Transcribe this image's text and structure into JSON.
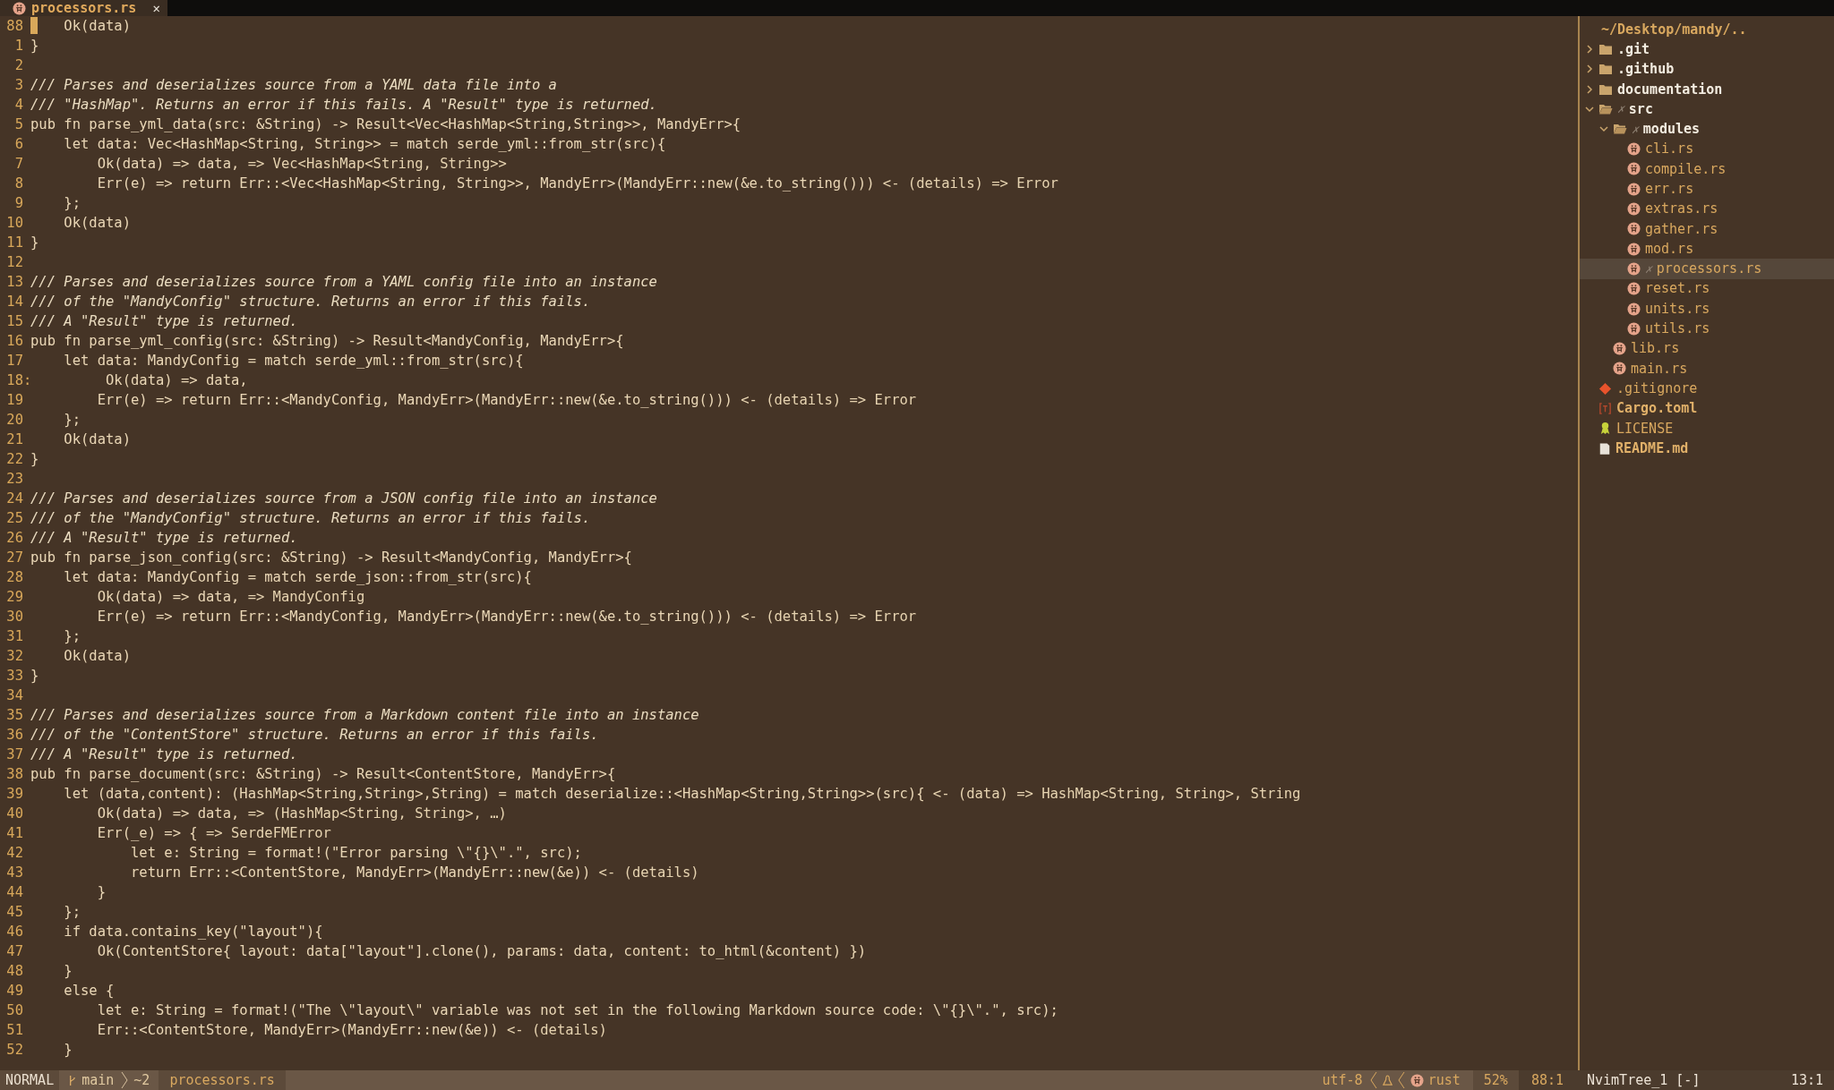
{
  "tab": {
    "title": "processors.rs",
    "selected": true,
    "close": "✕"
  },
  "editor": {
    "lines": [
      {
        "number": "88",
        "kind": "code",
        "code": "    Ok(data)",
        "cursor": true
      },
      {
        "number": "1",
        "kind": "code",
        "code": "}",
        "cursor": false
      },
      {
        "number": "2",
        "kind": "code",
        "cursor": false
      },
      {
        "number": "3",
        "kind": "comment",
        "code": "/// Parses and deserializes source from a YAML data file into a",
        "cursor": false
      },
      {
        "number": "4",
        "kind": "comment",
        "code": "/// \"HashMap\". Returns an error if this fails. A \"Result\" type is returned.",
        "cursor": false
      },
      {
        "number": "5",
        "kind": "code",
        "code": "pub fn parse_yml_data(src: &String) -> Result<Vec<HashMap<String,String>>, MandyErr>{",
        "cursor": false
      },
      {
        "number": "6",
        "kind": "code",
        "code": "    let data: Vec<HashMap<String, String>> = match serde_yml::from_str(src){",
        "cursor": false
      },
      {
        "number": "7",
        "kind": "code",
        "code": "        Ok(data) => data,",
        "hint": "=> Vec<HashMap<String, String>>",
        "cursor": false
      },
      {
        "number": "8",
        "kind": "code",
        "code": "        Err(e) => return Err::<Vec<HashMap<String, String>>, MandyErr>(MandyErr::new(&e.to_string()))",
        "hint": "<- (details) => Error",
        "cursor": false
      },
      {
        "number": "9",
        "kind": "code",
        "code": "    };",
        "cursor": false
      },
      {
        "number": "10",
        "kind": "code",
        "code": "    Ok(data)",
        "cursor": false
      },
      {
        "number": "11",
        "kind": "code",
        "code": "}",
        "cursor": false
      },
      {
        "number": "12",
        "kind": "code",
        "cursor": false
      },
      {
        "number": "13",
        "kind": "comment",
        "code": "/// Parses and deserializes source from a YAML config file into an instance",
        "cursor": false
      },
      {
        "number": "14",
        "kind": "comment",
        "code": "/// of the \"MandyConfig\" structure. Returns an error if this fails.",
        "cursor": false
      },
      {
        "number": "15",
        "kind": "comment",
        "code": "/// A \"Result\" type is returned.",
        "cursor": false
      },
      {
        "number": "16",
        "kind": "code",
        "code": "pub fn parse_yml_config(src: &String) -> Result<MandyConfig, MandyErr>{",
        "cursor": false
      },
      {
        "number": "17",
        "kind": "code",
        "code": "    let data: MandyConfig = match serde_yml::from_str(src){",
        "cursor": false
      },
      {
        "number": "18",
        "sign": ":",
        "kind": "code",
        "code": "         Ok(data) => data,",
        "cursor": false
      },
      {
        "number": "19",
        "kind": "code",
        "code": "        Err(e) => return Err::<MandyConfig, MandyErr>(MandyErr::new(&e.to_string()))",
        "hint": "<- (details) => Error",
        "cursor": false
      },
      {
        "number": "20",
        "kind": "code",
        "code": "    };",
        "cursor": false
      },
      {
        "number": "21",
        "kind": "code",
        "code": "    Ok(data)",
        "cursor": false
      },
      {
        "number": "22",
        "kind": "code",
        "code": "}",
        "cursor": false
      },
      {
        "number": "23",
        "kind": "code",
        "cursor": false
      },
      {
        "number": "24",
        "kind": "comment",
        "code": "/// Parses and deserializes source from a JSON config file into an instance",
        "cursor": false
      },
      {
        "number": "25",
        "kind": "comment",
        "code": "/// of the \"MandyConfig\" structure. Returns an error if this fails.",
        "cursor": false
      },
      {
        "number": "26",
        "kind": "comment",
        "code": "/// A \"Result\" type is returned.",
        "cursor": false
      },
      {
        "number": "27",
        "kind": "code",
        "code": "pub fn parse_json_config(src: &String) -> Result<MandyConfig, MandyErr>{",
        "cursor": false
      },
      {
        "number": "28",
        "kind": "code",
        "code": "    let data: MandyConfig = match serde_json::from_str(src){",
        "cursor": false
      },
      {
        "number": "29",
        "kind": "code",
        "code": "        Ok(data) => data,",
        "hint": "=> MandyConfig",
        "cursor": false
      },
      {
        "number": "30",
        "kind": "code",
        "code": "        Err(e) => return Err::<MandyConfig, MandyErr>(MandyErr::new(&e.to_string()))",
        "hint": "<- (details) => Error",
        "cursor": false
      },
      {
        "number": "31",
        "kind": "code",
        "code": "    };",
        "cursor": false
      },
      {
        "number": "32",
        "kind": "code",
        "code": "    Ok(data)",
        "cursor": false
      },
      {
        "number": "33",
        "kind": "code",
        "code": "}",
        "cursor": false
      },
      {
        "number": "34",
        "kind": "code",
        "cursor": false
      },
      {
        "number": "35",
        "kind": "comment",
        "code": "/// Parses and deserializes source from a Markdown content file into an instance",
        "cursor": false
      },
      {
        "number": "36",
        "kind": "comment",
        "code": "/// of the \"ContentStore\" structure. Returns an error if this fails.",
        "cursor": false
      },
      {
        "number": "37",
        "kind": "comment",
        "code": "/// A \"Result\" type is returned.",
        "cursor": false
      },
      {
        "number": "38",
        "kind": "code",
        "code": "pub fn parse_document(src: &String) -> Result<ContentStore, MandyErr>{",
        "cursor": false
      },
      {
        "number": "39",
        "kind": "code",
        "code": "    let (data,content): (HashMap<String,String>,String) = match deserialize::<HashMap<String,String>>(src){",
        "hint": "<- (data) => HashMap<String, String>, String",
        "cursor": false
      },
      {
        "number": "40",
        "kind": "code",
        "code": "        Ok(data) => data,",
        "hint": "=> (HashMap<String, String>, …)",
        "cursor": false
      },
      {
        "number": "41",
        "kind": "code",
        "code": "        Err(_e) => {",
        "hint": "=> SerdeFMError",
        "cursor": false
      },
      {
        "number": "42",
        "kind": "code",
        "code": "            let e: String = format!(\"Error parsing \\\"{}\\\".\", src);",
        "cursor": false
      },
      {
        "number": "43",
        "kind": "code",
        "code": "            return Err::<ContentStore, MandyErr>(MandyErr::new(&e))",
        "hint": "<- (details)",
        "cursor": false
      },
      {
        "number": "44",
        "kind": "code",
        "code": "        }",
        "cursor": false
      },
      {
        "number": "45",
        "kind": "code",
        "code": "    };",
        "cursor": false
      },
      {
        "number": "46",
        "kind": "code",
        "code": "    if data.contains_key(\"layout\"){",
        "cursor": false
      },
      {
        "number": "47",
        "kind": "code",
        "code": "        Ok(ContentStore{ layout: data[\"layout\"].clone(), params: data, content: to_html(&content) })",
        "cursor": false
      },
      {
        "number": "48",
        "kind": "code",
        "code": "    }",
        "cursor": false
      },
      {
        "number": "49",
        "kind": "code",
        "code": "    else {",
        "cursor": false
      },
      {
        "number": "50",
        "kind": "code",
        "code": "        let e: String = format!(\"The \\\"layout\\\" variable was not set in the following Markdown source code: \\\"{}\\\".\", src);",
        "cursor": false
      },
      {
        "number": "51",
        "kind": "code",
        "code": "        Err::<ContentStore, MandyErr>(MandyErr::new(&e))",
        "hint": "<- (details)",
        "cursor": false
      },
      {
        "number": "52",
        "kind": "code",
        "code": "    }",
        "cursor": false
      }
    ]
  },
  "file_tree": {
    "root": "~/Desktop/mandy/..",
    "modified_mark": "✗",
    "items": [
      {
        "name": ".git",
        "kind": "folder",
        "expanded": false,
        "modified": false,
        "selected": false,
        "emphasized": true
      },
      {
        "name": ".github",
        "kind": "folder",
        "expanded": false,
        "modified": false,
        "selected": false,
        "emphasized": true
      },
      {
        "name": "documentation",
        "kind": "folder",
        "expanded": false,
        "modified": false,
        "selected": false,
        "emphasized": true
      },
      {
        "name": "src",
        "kind": "folder",
        "expanded": true,
        "modified": true,
        "selected": false,
        "emphasized": true,
        "children": [
          {
            "name": "modules",
            "kind": "folder",
            "expanded": true,
            "modified": true,
            "selected": false,
            "emphasized": true,
            "children": [
              {
                "name": "cli.rs",
                "kind": "rust",
                "modified": false,
                "selected": false,
                "emphasized": false
              },
              {
                "name": "compile.rs",
                "kind": "rust",
                "modified": false,
                "selected": false,
                "emphasized": false
              },
              {
                "name": "err.rs",
                "kind": "rust",
                "modified": false,
                "selected": false,
                "emphasized": false
              },
              {
                "name": "extras.rs",
                "kind": "rust",
                "modified": false,
                "selected": false,
                "emphasized": false
              },
              {
                "name": "gather.rs",
                "kind": "rust",
                "modified": false,
                "selected": false,
                "emphasized": false
              },
              {
                "name": "mod.rs",
                "kind": "rust",
                "modified": false,
                "selected": false,
                "emphasized": false
              },
              {
                "name": "processors.rs",
                "kind": "rust",
                "modified": true,
                "selected": true,
                "emphasized": false
              },
              {
                "name": "reset.rs",
                "kind": "rust",
                "modified": false,
                "selected": false,
                "emphasized": false
              },
              {
                "name": "units.rs",
                "kind": "rust",
                "modified": false,
                "selected": false,
                "emphasized": false
              },
              {
                "name": "utils.rs",
                "kind": "rust",
                "modified": false,
                "selected": false,
                "emphasized": false
              }
            ]
          },
          {
            "name": "lib.rs",
            "kind": "rust",
            "modified": false,
            "selected": false,
            "emphasized": false
          },
          {
            "name": "main.rs",
            "kind": "rust",
            "modified": false,
            "selected": false,
            "emphasized": false
          }
        ]
      },
      {
        "name": ".gitignore",
        "kind": "git",
        "modified": false,
        "selected": false,
        "emphasized": false
      },
      {
        "name": "Cargo.toml",
        "kind": "toml",
        "modified": false,
        "selected": false,
        "emphasized": true
      },
      {
        "name": "LICENSE",
        "kind": "license",
        "modified": false,
        "selected": false,
        "emphasized": false
      },
      {
        "name": "README.md",
        "kind": "readme",
        "modified": false,
        "selected": false,
        "emphasized": true
      }
    ]
  },
  "status_bar": {
    "mode": "NORMAL",
    "branch": "main",
    "changes": "~2",
    "file": "processors.rs",
    "encoding": "utf-8",
    "filetype": "rust",
    "progress": "52%",
    "position": "88:1",
    "tree_name": "NvimTree_1 [-]",
    "tree_position": "13:1"
  }
}
